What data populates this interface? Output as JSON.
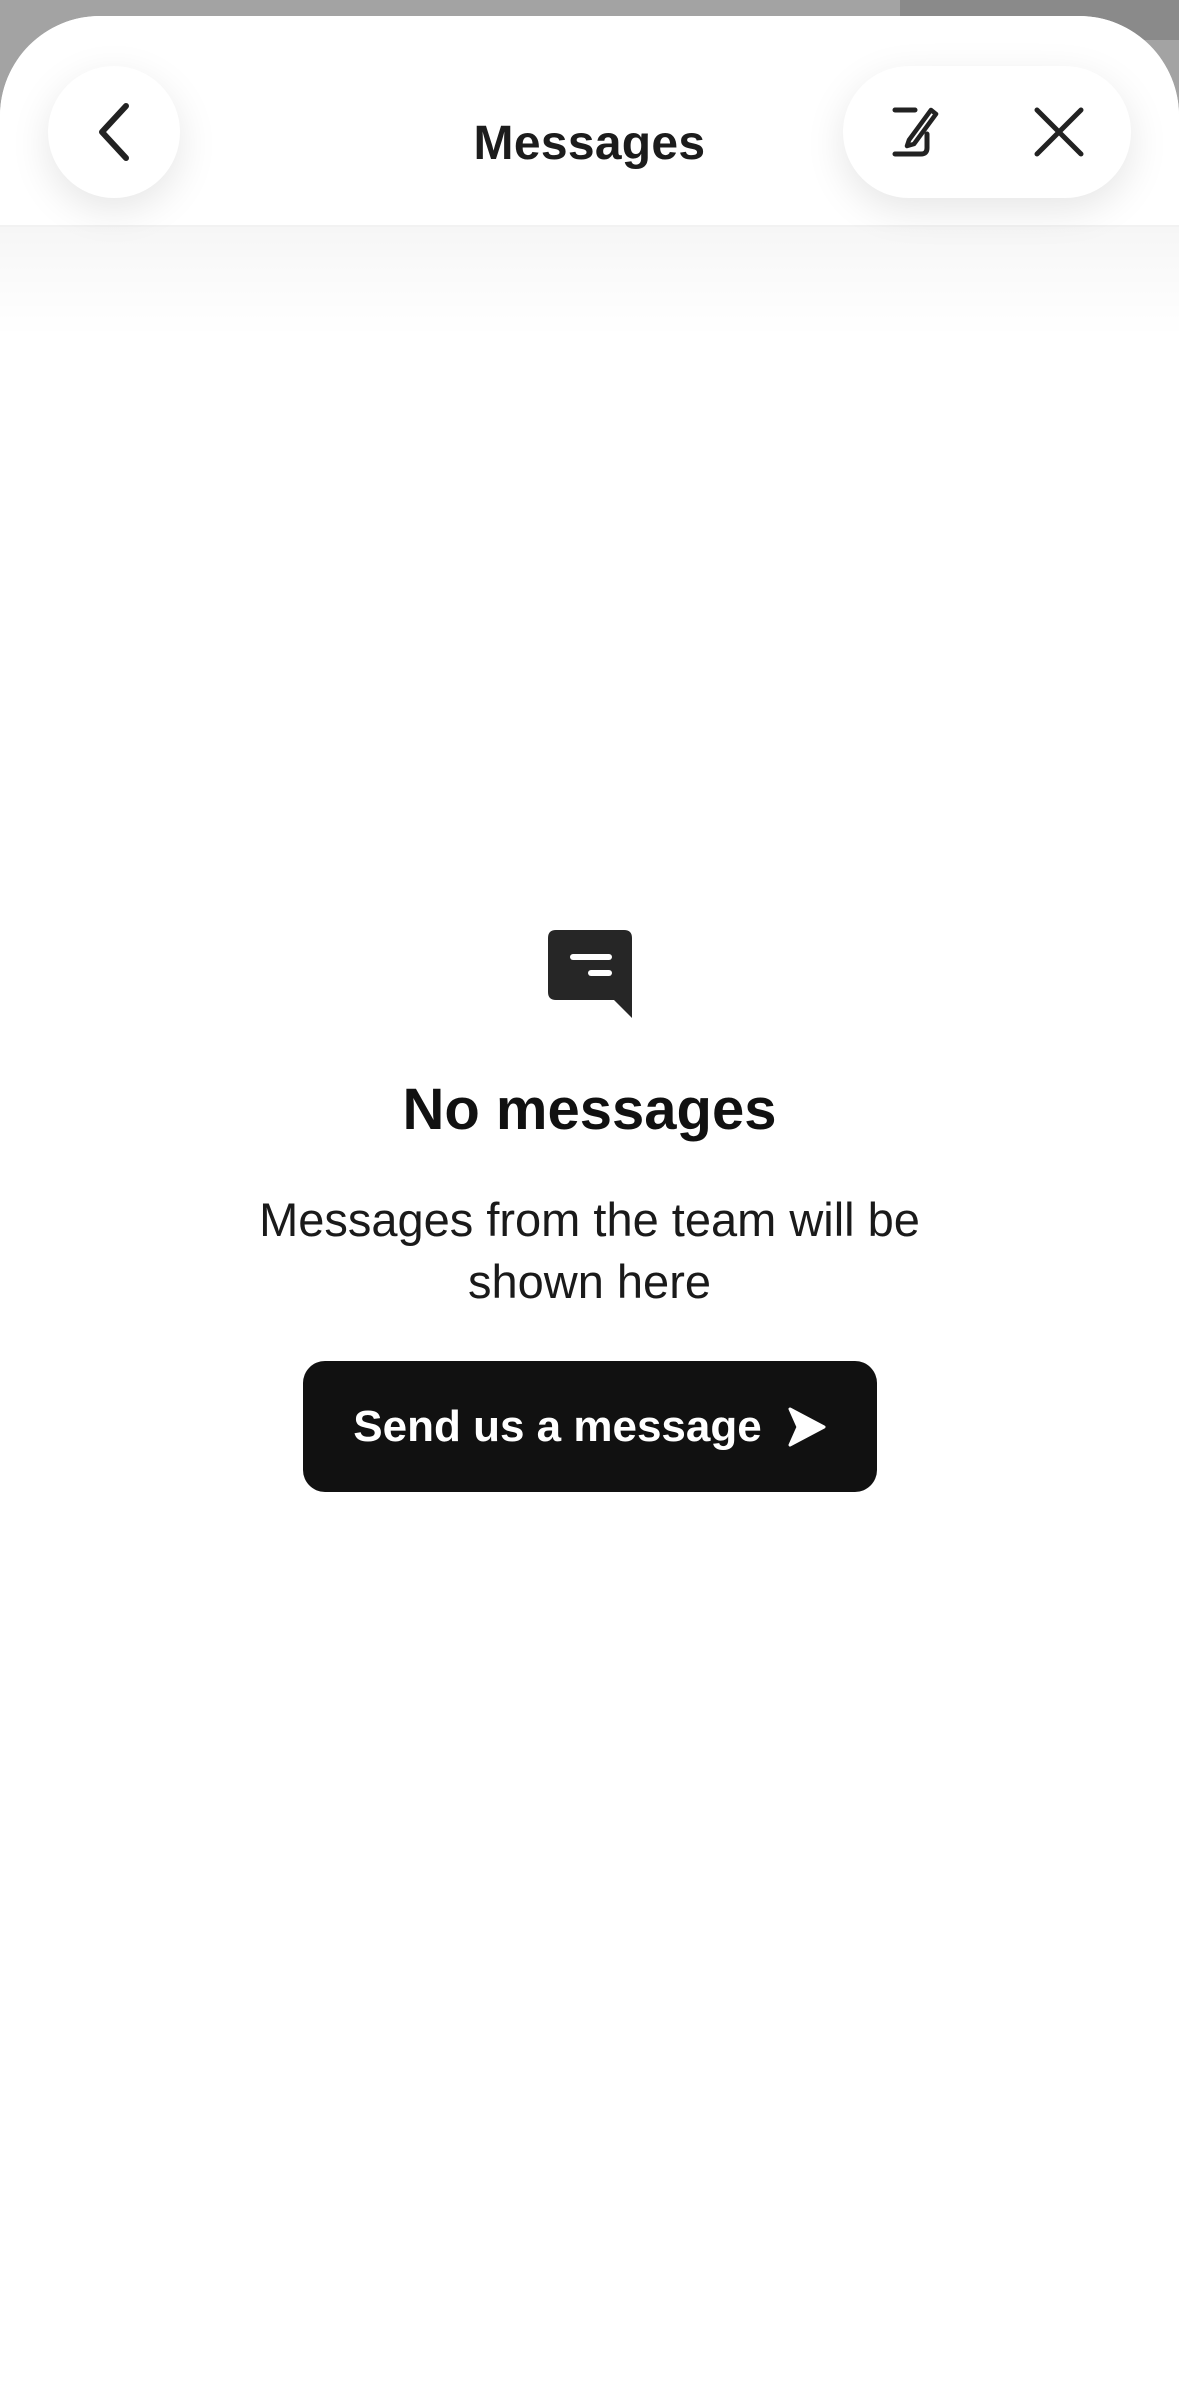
{
  "header": {
    "title": "Messages"
  },
  "empty_state": {
    "title": "No messages",
    "subtitle": "Messages from the team will be shown here",
    "button_label": "Send us a message"
  },
  "icons": {
    "back": "chevron-left-icon",
    "compose": "compose-icon",
    "close": "close-icon",
    "empty": "chat-bubble-icon",
    "send": "send-arrow-icon"
  },
  "colors": {
    "primary_button": "#111111",
    "background": "#ffffff"
  }
}
